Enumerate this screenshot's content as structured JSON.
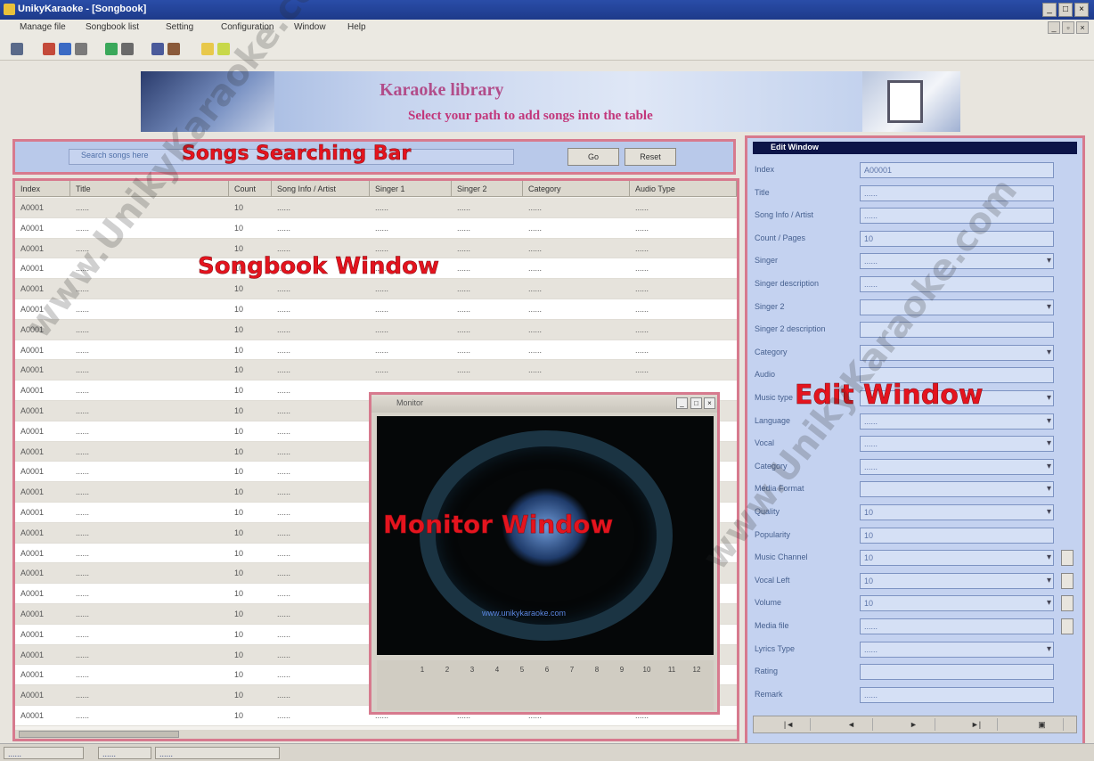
{
  "window": {
    "title": "UnikyKaraoke - [Songbook]",
    "minimize": "_",
    "maximize": "□",
    "close": "×"
  },
  "menu": [
    "Manage file",
    "Songbook list",
    "Setting",
    "Configuration",
    "Window",
    "Help"
  ],
  "banner": {
    "title": "Karaoke library",
    "subtitle": "Select your path to add songs into the table"
  },
  "search": {
    "placeholder": "Search songs here",
    "go_label": "Go",
    "reset_label": "Reset"
  },
  "annotations": {
    "search_bar": "Songs Searching Bar",
    "songbook": "Songbook Window",
    "monitor": "Monitor Window",
    "edit": "Edit Window"
  },
  "songbook": {
    "columns": [
      "Index",
      "Title",
      "Count",
      "Song Info / Artist",
      "Singer 1",
      "Singer 2",
      "Category",
      "Audio Type"
    ],
    "rows_count_note": "",
    "rows": [
      [
        "A0001",
        "......",
        "10",
        "......",
        "......",
        "......",
        "......",
        "......"
      ]
    ]
  },
  "monitor": {
    "caption": "Monitor",
    "url": "www.unikykaraoke.com",
    "controls": [
      "1",
      "2",
      "3",
      "4",
      "5",
      "6",
      "7",
      "8",
      "9",
      "10",
      "11",
      "12"
    ]
  },
  "edit": {
    "title": "Edit Window",
    "fields": [
      {
        "label": "Index",
        "value": "A00001",
        "type": "text"
      },
      {
        "label": "Title",
        "value": "......",
        "type": "text"
      },
      {
        "label": "Song Info / Artist",
        "value": "......",
        "type": "text"
      },
      {
        "label": "Count / Pages",
        "value": "10",
        "type": "text"
      },
      {
        "label": "Singer",
        "value": "......",
        "type": "dropdown"
      },
      {
        "label": "Singer description",
        "value": "......",
        "type": "text"
      },
      {
        "label": "Singer 2",
        "value": "",
        "type": "dropdown"
      },
      {
        "label": "Singer 2 description",
        "value": "",
        "type": "text"
      },
      {
        "label": "Category",
        "value": "",
        "type": "dropdown"
      },
      {
        "label": "Audio",
        "value": "",
        "type": "text"
      },
      {
        "label": "Music type",
        "value": "",
        "type": "dropdown"
      },
      {
        "label": "Language",
        "value": "......",
        "type": "dropdown"
      },
      {
        "label": "Vocal",
        "value": "......",
        "type": "dropdown"
      },
      {
        "label": "Category",
        "value": "......",
        "type": "dropdown"
      },
      {
        "label": "Media Format",
        "value": "",
        "type": "dropdown"
      },
      {
        "label": "Quality",
        "value": "10",
        "type": "dropdown"
      },
      {
        "label": "Popularity",
        "value": "10",
        "type": "text"
      },
      {
        "label": "Music Channel",
        "value": "10",
        "type": "dropdown",
        "spin": true
      },
      {
        "label": "Vocal Left",
        "value": "10",
        "type": "dropdown",
        "spin": true
      },
      {
        "label": "Volume",
        "value": "10",
        "type": "dropdown",
        "spin": true
      },
      {
        "label": "Media file",
        "value": "......",
        "type": "text",
        "spin": true
      },
      {
        "label": "Lyrics Type",
        "value": "......",
        "type": "dropdown"
      },
      {
        "label": "Rating",
        "value": "",
        "type": "text"
      },
      {
        "label": "Remark",
        "value": "......",
        "type": "text"
      }
    ],
    "nav": [
      "|◄",
      "◄",
      "►",
      "►|",
      "▣"
    ],
    "status": "......"
  },
  "status": {
    "panels": [
      "......",
      "......",
      "......"
    ]
  },
  "watermark": "www.UnikyKaraoke.com"
}
